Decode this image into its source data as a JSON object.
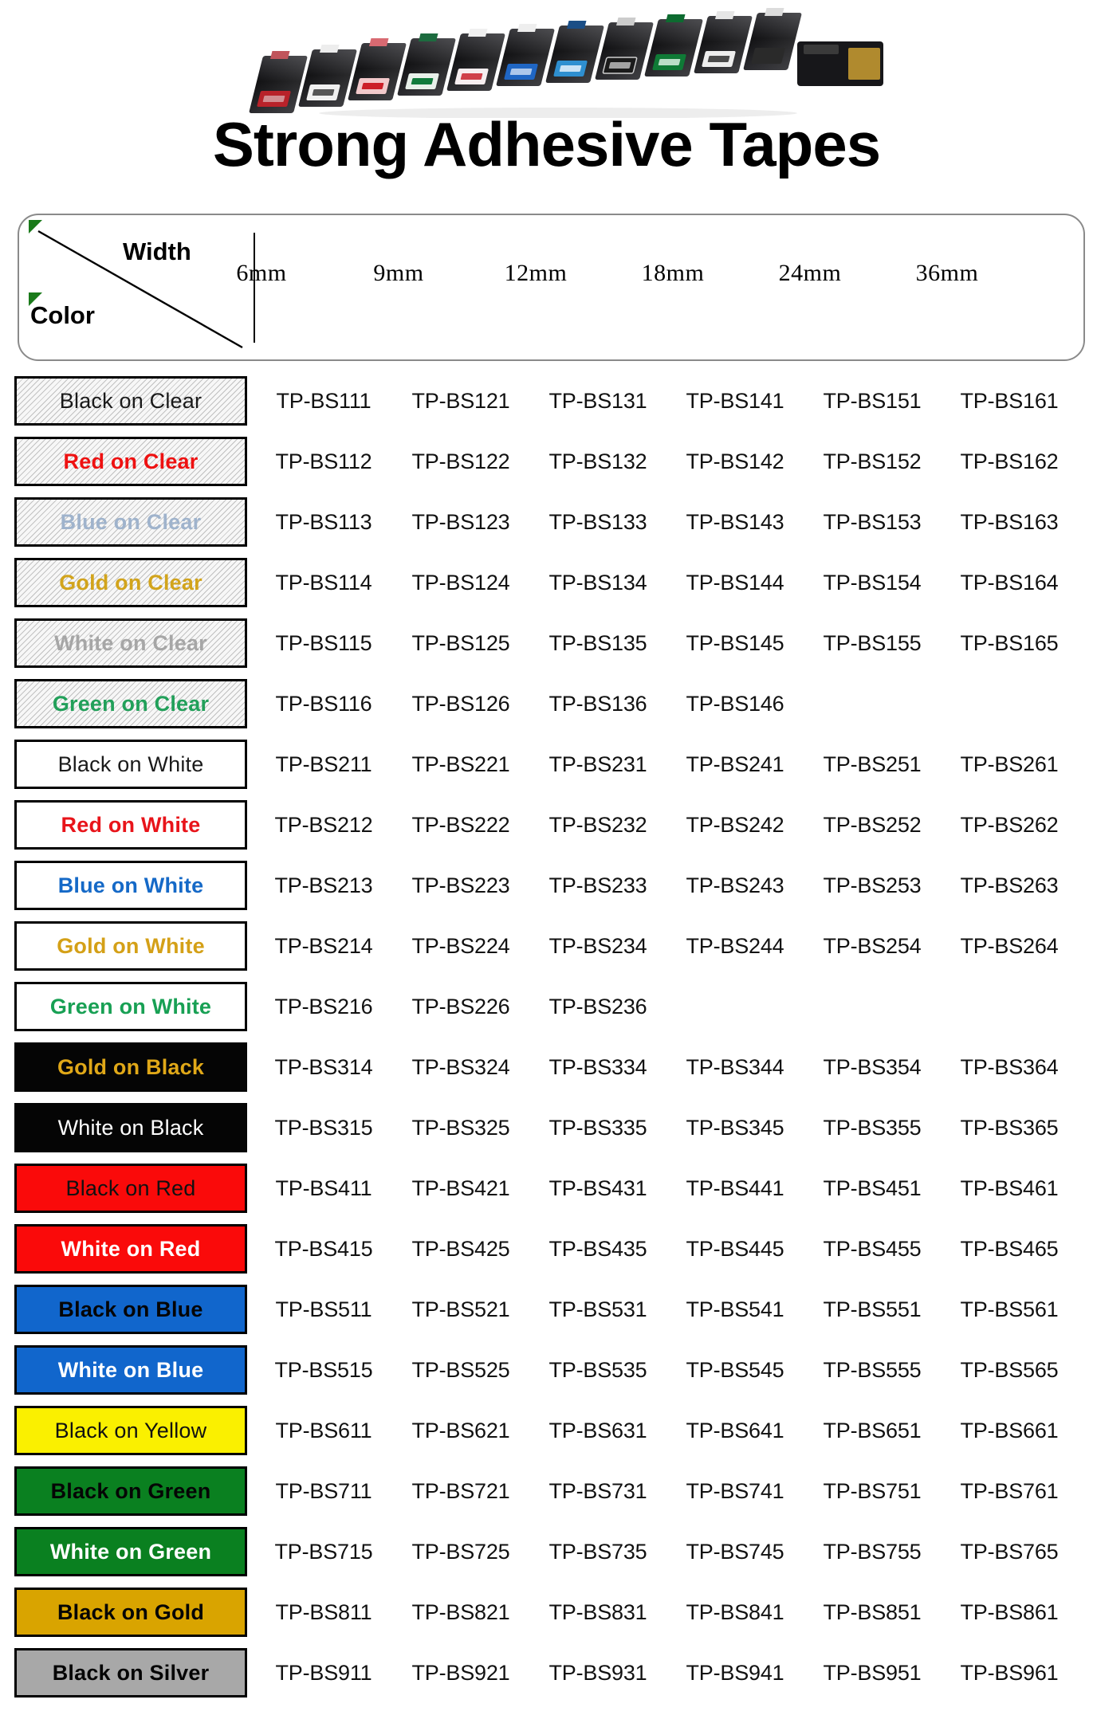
{
  "hero": {
    "title": "Strong Adhesive Tapes",
    "photo_alt": "row of label tape cassettes"
  },
  "table": {
    "corner": {
      "width_label": "Width",
      "color_label": "Color"
    },
    "columns": [
      "6mm",
      "9mm",
      "12mm",
      "18mm",
      "24mm",
      "36mm"
    ],
    "rows": [
      {
        "label": "Black on Clear",
        "bg": "#f7f7f7",
        "fg": "#1a1a1a",
        "hatched": true,
        "bold": false,
        "border": "#000000",
        "codes": [
          "TP-BS111",
          "TP-BS121",
          "TP-BS131",
          "TP-BS141",
          "TP-BS151",
          "TP-BS161"
        ]
      },
      {
        "label": "Red on Clear",
        "bg": "#f7f7f7",
        "fg": "#ee1111",
        "hatched": true,
        "bold": true,
        "border": "#000000",
        "codes": [
          "TP-BS112",
          "TP-BS122",
          "TP-BS132",
          "TP-BS142",
          "TP-BS152",
          "TP-BS162"
        ]
      },
      {
        "label": "Blue on Clear",
        "bg": "#f7f7f7",
        "fg": "#9fb3cc",
        "hatched": true,
        "bold": true,
        "border": "#000000",
        "codes": [
          "TP-BS113",
          "TP-BS123",
          "TP-BS133",
          "TP-BS143",
          "TP-BS153",
          "TP-BS163"
        ]
      },
      {
        "label": "Gold on Clear",
        "bg": "#f7f7f7",
        "fg": "#d2a41c",
        "hatched": true,
        "bold": true,
        "border": "#000000",
        "codes": [
          "TP-BS114",
          "TP-BS124",
          "TP-BS134",
          "TP-BS144",
          "TP-BS154",
          "TP-BS164"
        ]
      },
      {
        "label": "White on Clear",
        "bg": "#f7f7f7",
        "fg": "#a6a6a6",
        "hatched": true,
        "bold": true,
        "border": "#000000",
        "codes": [
          "TP-BS115",
          "TP-BS125",
          "TP-BS135",
          "TP-BS145",
          "TP-BS155",
          "TP-BS165"
        ]
      },
      {
        "label": "Green on Clear",
        "bg": "#f7f7f7",
        "fg": "#22a05a",
        "hatched": true,
        "bold": true,
        "border": "#000000",
        "codes": [
          "TP-BS116",
          "TP-BS126",
          "TP-BS136",
          "TP-BS146",
          "",
          ""
        ]
      },
      {
        "label": "Black on White",
        "bg": "#ffffff",
        "fg": "#1a1a1a",
        "hatched": false,
        "bold": false,
        "border": "#000000",
        "codes": [
          "TP-BS211",
          "TP-BS221",
          "TP-BS231",
          "TP-BS241",
          "TP-BS251",
          "TP-BS261"
        ]
      },
      {
        "label": "Red on White",
        "bg": "#ffffff",
        "fg": "#e8141a",
        "hatched": false,
        "bold": true,
        "border": "#000000",
        "codes": [
          "TP-BS212",
          "TP-BS222",
          "TP-BS232",
          "TP-BS242",
          "TP-BS252",
          "TP-BS262"
        ]
      },
      {
        "label": "Blue on White",
        "bg": "#ffffff",
        "fg": "#1569c7",
        "hatched": false,
        "bold": true,
        "border": "#000000",
        "codes": [
          "TP-BS213",
          "TP-BS223",
          "TP-BS233",
          "TP-BS243",
          "TP-BS253",
          "TP-BS263"
        ]
      },
      {
        "label": "Gold on White",
        "bg": "#ffffff",
        "fg": "#d4a017",
        "hatched": false,
        "bold": true,
        "border": "#000000",
        "codes": [
          "TP-BS214",
          "TP-BS224",
          "TP-BS234",
          "TP-BS244",
          "TP-BS254",
          "TP-BS264"
        ]
      },
      {
        "label": "Green on White",
        "bg": "#ffffff",
        "fg": "#18a054",
        "hatched": false,
        "bold": true,
        "border": "#000000",
        "codes": [
          "TP-BS216",
          "TP-BS226",
          "TP-BS236",
          "",
          "",
          ""
        ]
      },
      {
        "label": "Gold on Black",
        "bg": "#050505",
        "fg": "#e0a818",
        "hatched": false,
        "bold": true,
        "border": "#050505",
        "codes": [
          "TP-BS314",
          "TP-BS324",
          "TP-BS334",
          "TP-BS344",
          "TP-BS354",
          "TP-BS364"
        ]
      },
      {
        "label": "White on Black",
        "bg": "#050505",
        "fg": "#ffffff",
        "hatched": false,
        "bold": false,
        "border": "#050505",
        "codes": [
          "TP-BS315",
          "TP-BS325",
          "TP-BS335",
          "TP-BS345",
          "TP-BS355",
          "TP-BS365"
        ]
      },
      {
        "label": "Black on Red",
        "bg": "#fa0a0a",
        "fg": "#111111",
        "hatched": false,
        "bold": false,
        "border": "#000000",
        "codes": [
          "TP-BS411",
          "TP-BS421",
          "TP-BS431",
          "TP-BS441",
          "TP-BS451",
          "TP-BS461"
        ]
      },
      {
        "label": "White on Red",
        "bg": "#fa0a0a",
        "fg": "#ffffff",
        "hatched": false,
        "bold": true,
        "border": "#000000",
        "codes": [
          "TP-BS415",
          "TP-BS425",
          "TP-BS435",
          "TP-BS445",
          "TP-BS455",
          "TP-BS465"
        ]
      },
      {
        "label": "Black on Blue",
        "bg": "#1166cc",
        "fg": "#050505",
        "hatched": false,
        "bold": true,
        "border": "#000000",
        "codes": [
          "TP-BS511",
          "TP-BS521",
          "TP-BS531",
          "TP-BS541",
          "TP-BS551",
          "TP-BS561"
        ]
      },
      {
        "label": "White on Blue",
        "bg": "#1166cc",
        "fg": "#ffffff",
        "hatched": false,
        "bold": true,
        "border": "#000000",
        "codes": [
          "TP-BS515",
          "TP-BS525",
          "TP-BS535",
          "TP-BS545",
          "TP-BS555",
          "TP-BS565"
        ]
      },
      {
        "label": "Black on Yellow",
        "bg": "#faf000",
        "fg": "#111111",
        "hatched": false,
        "bold": false,
        "border": "#000000",
        "codes": [
          "TP-BS611",
          "TP-BS621",
          "TP-BS631",
          "TP-BS641",
          "TP-BS651",
          "TP-BS661"
        ]
      },
      {
        "label": "Black on Green",
        "bg": "#0a8020",
        "fg": "#050505",
        "hatched": false,
        "bold": true,
        "border": "#000000",
        "codes": [
          "TP-BS711",
          "TP-BS721",
          "TP-BS731",
          "TP-BS741",
          "TP-BS751",
          "TP-BS761"
        ]
      },
      {
        "label": "White on Green",
        "bg": "#0a8020",
        "fg": "#ffffff",
        "hatched": false,
        "bold": true,
        "border": "#000000",
        "codes": [
          "TP-BS715",
          "TP-BS725",
          "TP-BS735",
          "TP-BS745",
          "TP-BS755",
          "TP-BS765"
        ]
      },
      {
        "label": "Black on Gold",
        "bg": "#d9a400",
        "fg": "#050505",
        "hatched": false,
        "bold": true,
        "border": "#000000",
        "codes": [
          "TP-BS811",
          "TP-BS821",
          "TP-BS831",
          "TP-BS841",
          "TP-BS851",
          "TP-BS861"
        ]
      },
      {
        "label": "Black on Silver",
        "bg": "#a8a8a8",
        "fg": "#050505",
        "hatched": false,
        "bold": true,
        "border": "#000000",
        "codes": [
          "TP-BS911",
          "TP-BS921",
          "TP-BS931",
          "TP-BS941",
          "TP-BS951",
          "TP-BS961"
        ]
      }
    ]
  },
  "accents": {
    "corner_marker": "#1a7a1a",
    "header_border": "#8a8a8a"
  }
}
